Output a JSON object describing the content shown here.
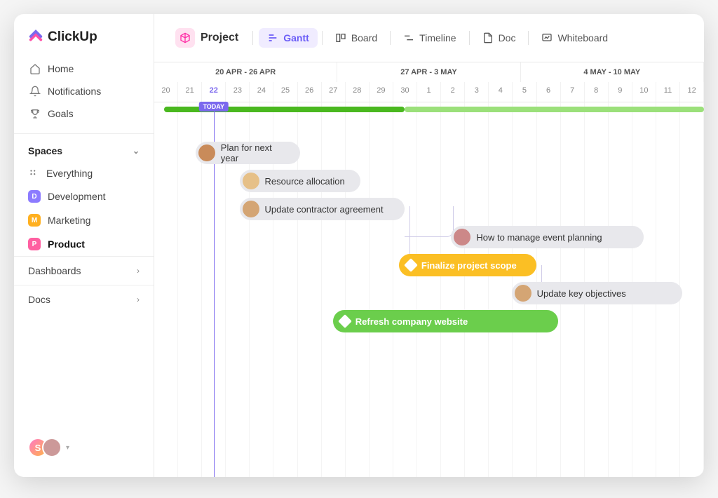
{
  "logo": {
    "text": "ClickUp"
  },
  "nav": [
    {
      "icon": "home",
      "label": "Home"
    },
    {
      "icon": "bell",
      "label": "Notifications"
    },
    {
      "icon": "trophy",
      "label": "Goals"
    }
  ],
  "spaces": {
    "header": "Spaces",
    "everything": "Everything",
    "items": [
      {
        "letter": "D",
        "color": "#8c7bff",
        "label": "Development"
      },
      {
        "letter": "M",
        "color": "#ffb020",
        "label": "Marketing"
      },
      {
        "letter": "P",
        "color": "#ff5fa1",
        "label": "Product",
        "active": true
      }
    ]
  },
  "menu": {
    "dashboards": "Dashboards",
    "docs": "Docs"
  },
  "user": {
    "initial": "S"
  },
  "toolbar": {
    "project_label": "Project",
    "views": [
      {
        "id": "gantt",
        "label": "Gantt",
        "active": true
      },
      {
        "id": "board",
        "label": "Board"
      },
      {
        "id": "timeline",
        "label": "Timeline"
      },
      {
        "id": "doc",
        "label": "Doc"
      },
      {
        "id": "whiteboard",
        "label": "Whiteboard"
      }
    ]
  },
  "timeline": {
    "weeks": [
      "20 APR - 26 APR",
      "27 APR - 3 MAY",
      "4 MAY - 10 MAY"
    ],
    "days": [
      "20",
      "21",
      "22",
      "23",
      "24",
      "25",
      "26",
      "27",
      "28",
      "29",
      "30",
      "1",
      "2",
      "3",
      "4",
      "5",
      "6",
      "7",
      "8",
      "9",
      "10",
      "11",
      "12"
    ],
    "today_index": 2,
    "today_label": "TODAY"
  },
  "progress": {
    "done_start_pct": 1.8,
    "done_end_pct": 45.5,
    "remain_start_pct": 45.5,
    "remain_end_pct": 100,
    "done_color": "#4ab81f",
    "remain_color": "#9be07a"
  },
  "tasks": [
    {
      "label": "Plan for next year",
      "style": "gray",
      "avatar": "#c98b5a",
      "row": 0,
      "start_pct": 7.5,
      "width_pct": 19
    },
    {
      "label": "Resource allocation",
      "style": "gray",
      "avatar": "#e6c088",
      "row": 1,
      "start_pct": 15.5,
      "width_pct": 22
    },
    {
      "label": "Update contractor agreement",
      "style": "gray",
      "avatar": "#d4a574",
      "row": 2,
      "start_pct": 15.5,
      "width_pct": 30
    },
    {
      "label": "How to manage event planning",
      "style": "gray",
      "avatar": "#c88",
      "row": 3,
      "start_pct": 54,
      "width_pct": 35
    },
    {
      "label": "Finalize project scope",
      "style": "yellow",
      "diamond": true,
      "row": 4,
      "start_pct": 44.5,
      "width_pct": 25
    },
    {
      "label": "Update key objectives",
      "style": "gray",
      "avatar": "#d4a574",
      "row": 5,
      "start_pct": 65,
      "width_pct": 31
    },
    {
      "label": "Refresh company website",
      "style": "green",
      "diamond": true,
      "row": 6,
      "start_pct": 32.5,
      "width_pct": 41
    }
  ],
  "colors": {
    "accent": "#7b68ee"
  }
}
